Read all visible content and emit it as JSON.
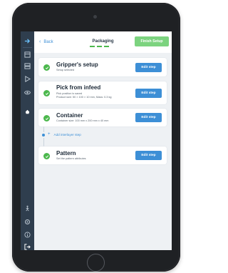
{
  "header": {
    "back_label": "Back",
    "title": "Packaging",
    "finish_label": "Finish Setup"
  },
  "sidebar": {
    "items": [
      {
        "icon": "arrow-right-icon"
      },
      {
        "icon": "window-icon"
      },
      {
        "icon": "layers-icon"
      },
      {
        "icon": "play-icon"
      },
      {
        "icon": "eye-icon"
      },
      {
        "icon": "hand-icon"
      },
      {
        "icon": "person-walk-icon"
      },
      {
        "icon": "settings-icon"
      },
      {
        "icon": "info-icon"
      },
      {
        "icon": "logout-icon"
      }
    ]
  },
  "steps": [
    {
      "title": "Gripper's setup",
      "lines": [
        "Setup selected"
      ],
      "action": "Edit step"
    },
    {
      "title": "Pick from infeed",
      "lines": [
        "Pick position is saved",
        "Product size: 50 × 100 × 10 mm, Mass: 0.3 kg"
      ],
      "action": "Edit step"
    },
    {
      "title": "Container",
      "lines": [
        "Container size: 100 mm x 200 mm x 40 mm"
      ],
      "action": "Edit step"
    },
    {
      "title": "Pattern",
      "lines": [
        "Set the pattern attributes"
      ],
      "action": "Edit step"
    }
  ],
  "interlayer": {
    "label": "Add interlayer step"
  },
  "colors": {
    "accent": "#3d8fd6",
    "success": "#4cb84d",
    "finish": "#7cd37f",
    "sidebar": "#2f3e4e"
  }
}
